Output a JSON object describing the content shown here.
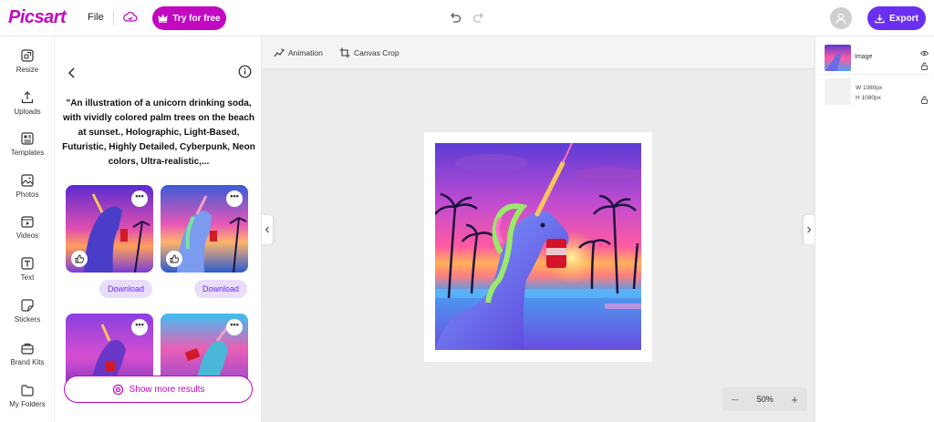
{
  "brand": {
    "name": "Picsart",
    "accent": "#c209c1",
    "export_color": "#6b2ff2"
  },
  "topbar": {
    "file_label": "File",
    "try_label": "Try for free",
    "export_label": "Export"
  },
  "leftnav": {
    "items": [
      {
        "label": "Resize",
        "icon": "resize-icon"
      },
      {
        "label": "Uploads",
        "icon": "upload-icon"
      },
      {
        "label": "Templates",
        "icon": "templates-icon"
      },
      {
        "label": "Photos",
        "icon": "photo-icon"
      },
      {
        "label": "Videos",
        "icon": "video-icon"
      },
      {
        "label": "Text",
        "icon": "text-icon"
      },
      {
        "label": "Stickers",
        "icon": "sticker-icon"
      },
      {
        "label": "Brand Kits",
        "icon": "brand-kit-icon"
      },
      {
        "label": "My Folders",
        "icon": "folder-icon"
      }
    ]
  },
  "panel": {
    "prompt": "\"An illustration of a unicorn drinking soda, with vividly colored palm trees on the beach at sunset., Holographic, Light-Based, Futuristic, Highly Detailed, Cyberpunk, Neon colors, Ultra-realistic,...",
    "download_label": "Download",
    "more_label": "•••",
    "show_more_label": "Show more results"
  },
  "canvas": {
    "tools": {
      "animation": "Animation",
      "canvas_crop": "Canvas Crop"
    },
    "zoom": "50%",
    "zoom_minus": "—",
    "zoom_plus": "+"
  },
  "layers": {
    "image_name": "Image",
    "width": "W  1080px",
    "height": "H  1080px"
  }
}
